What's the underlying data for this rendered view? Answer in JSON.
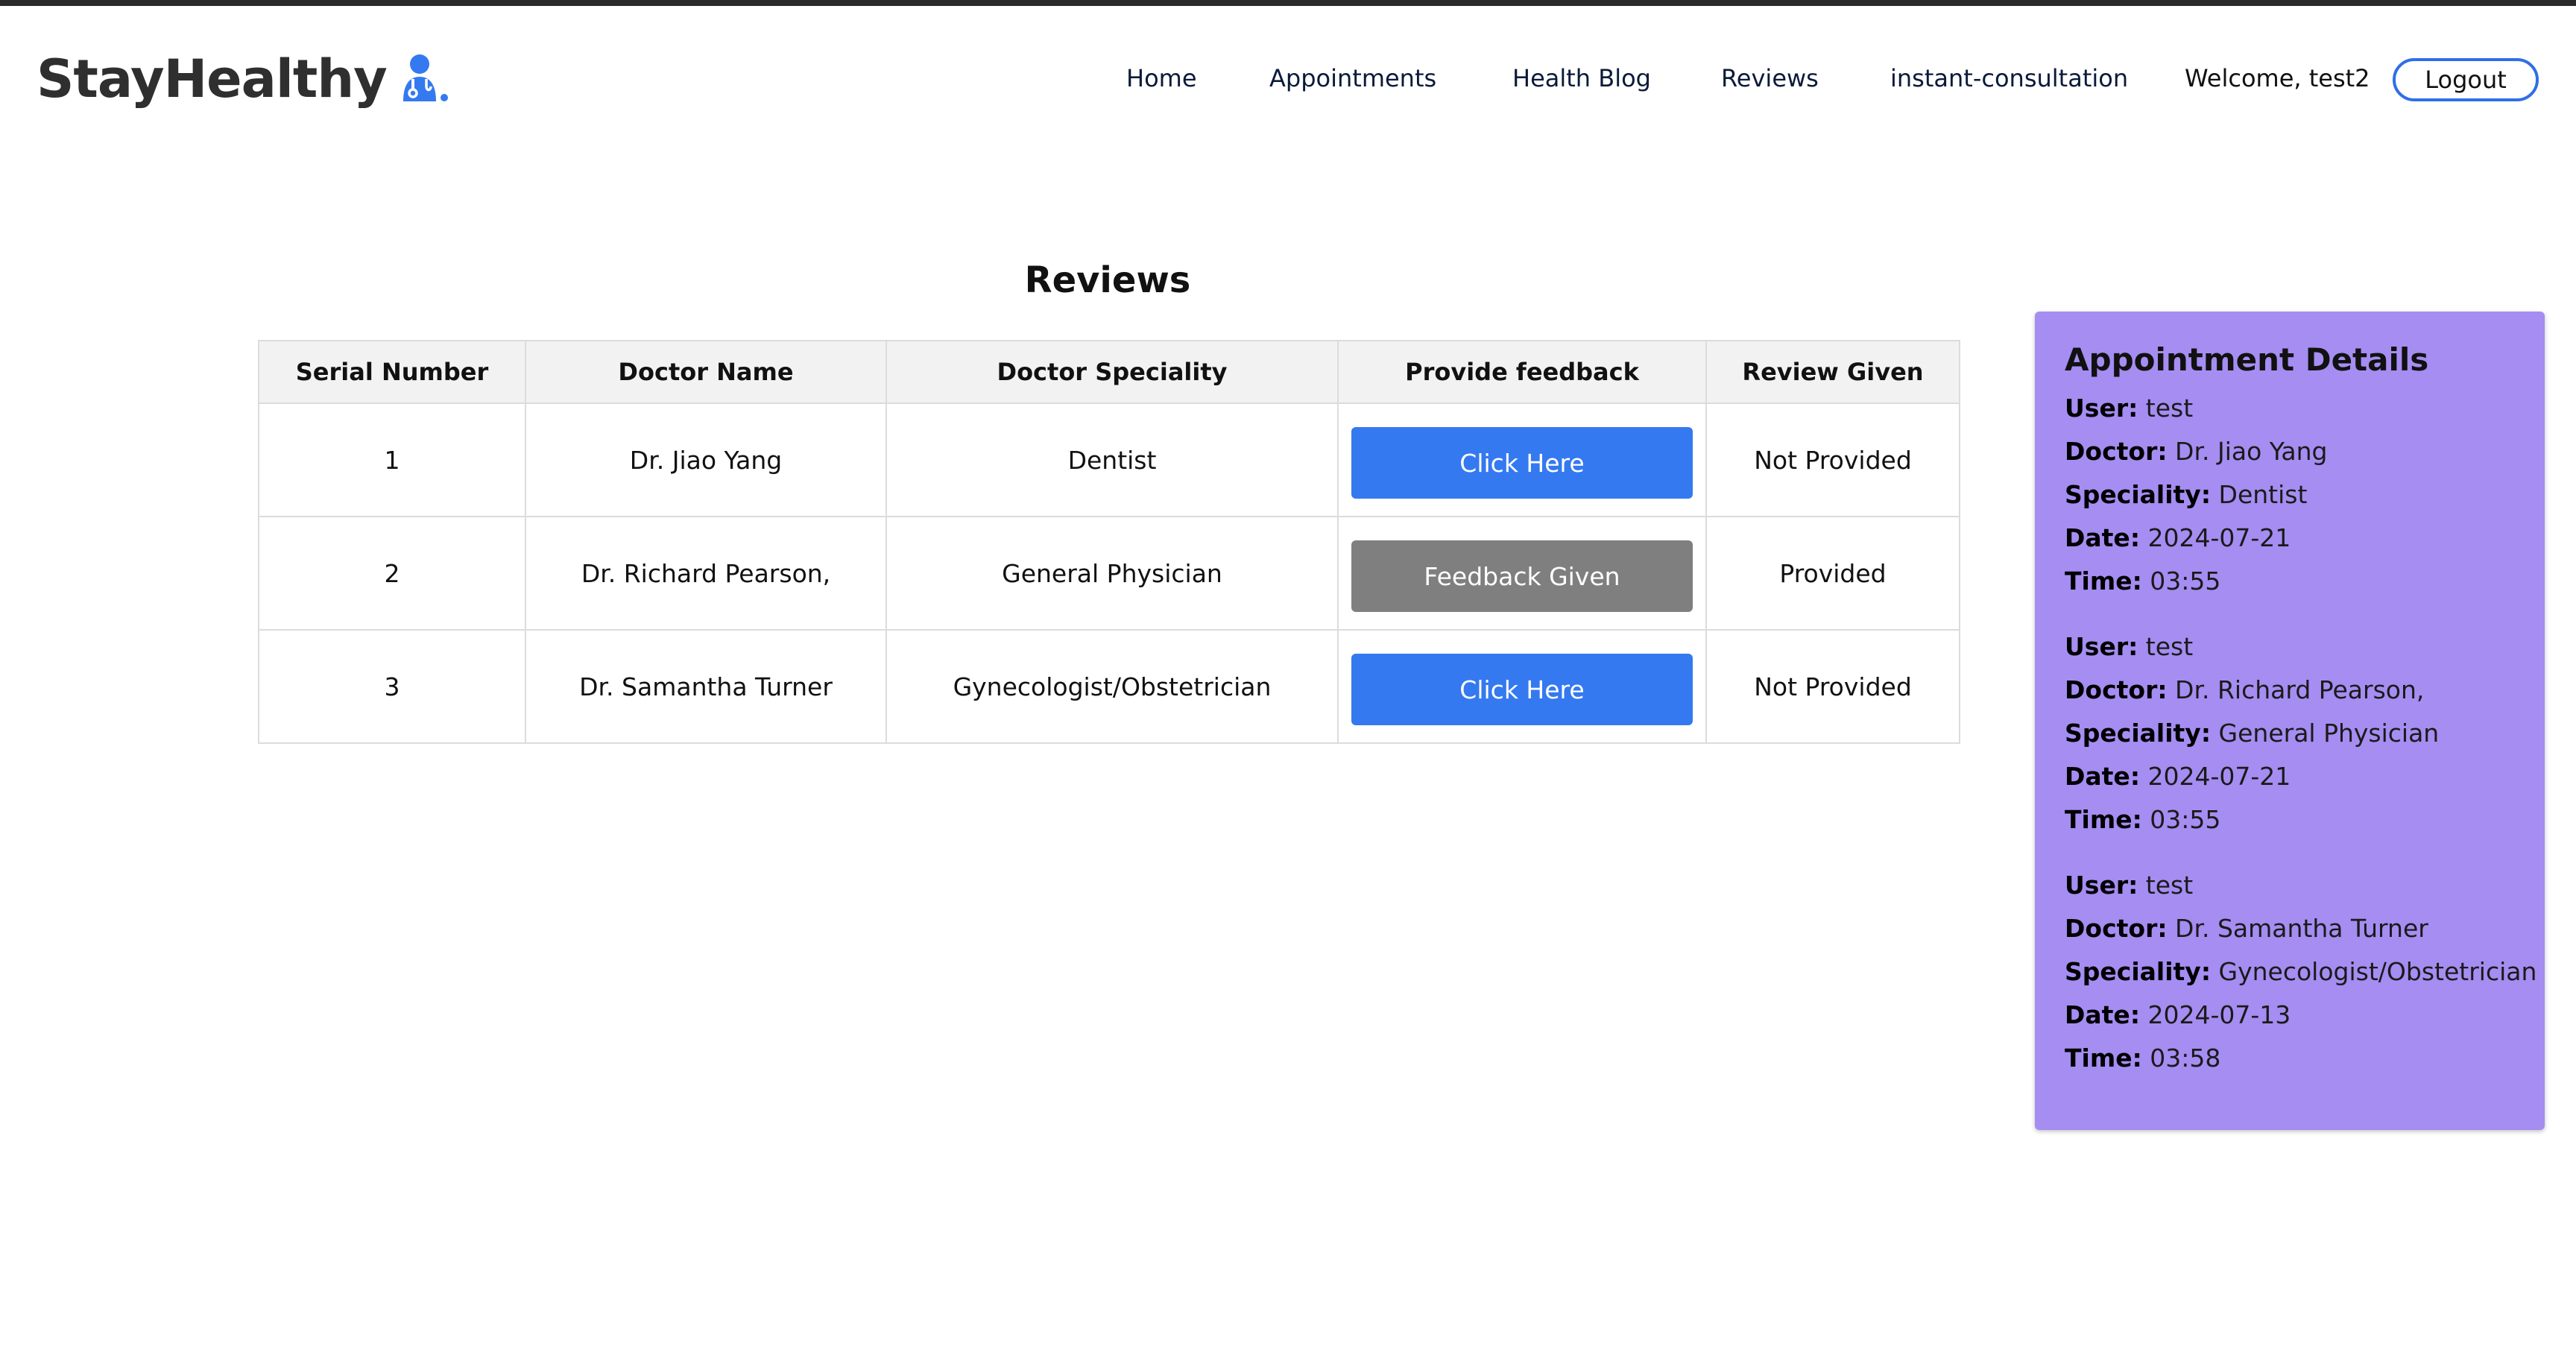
{
  "brand": {
    "name": "StayHealthy",
    "logo_icon": "doctor-icon",
    "logo_color": "#3479f0"
  },
  "nav": {
    "links": [
      {
        "label": "Home"
      },
      {
        "label": "Appointments"
      },
      {
        "label": "Health Blog"
      },
      {
        "label": "Reviews"
      },
      {
        "label": "instant-consultation"
      }
    ],
    "welcome": "Welcome, test2",
    "logout_label": "Logout"
  },
  "main": {
    "title": "Reviews",
    "table": {
      "headers": [
        "Serial Number",
        "Doctor Name",
        "Doctor Speciality",
        "Provide feedback",
        "Review Given"
      ],
      "rows": [
        {
          "serial": "1",
          "doctor": "Dr. Jiao Yang",
          "speciality": "Dentist",
          "action": "Click Here",
          "action_state": "enabled",
          "review": "Not Provided"
        },
        {
          "serial": "2",
          "doctor": "Dr. Richard Pearson,",
          "speciality": "General Physician",
          "action": "Feedback Given",
          "action_state": "disabled",
          "review": "Provided"
        },
        {
          "serial": "3",
          "doctor": "Dr. Samantha Turner",
          "speciality": "Gynecologist/Obstetrician",
          "action": "Click Here",
          "action_state": "enabled",
          "review": "Not Provided"
        }
      ]
    }
  },
  "side_panel": {
    "title": "Appointment Details",
    "labels": {
      "user": "User:",
      "doctor": "Doctor:",
      "speciality": "Speciality:",
      "date": "Date:",
      "time": "Time:"
    },
    "appointments": [
      {
        "user": "test",
        "doctor": "Dr. Jiao Yang",
        "speciality": "Dentist",
        "date": "2024-07-21",
        "time": "03:55"
      },
      {
        "user": "test",
        "doctor": "Dr. Richard Pearson,",
        "speciality": "General Physician",
        "date": "2024-07-21",
        "time": "03:55"
      },
      {
        "user": "test",
        "doctor": "Dr. Samantha Turner",
        "speciality": "Gynecologist/Obstetrician",
        "date": "2024-07-13",
        "time": "03:58"
      }
    ]
  },
  "colors": {
    "primary_button": "#3479f0",
    "disabled_button": "#7f7f7f",
    "panel_background": "#a58df2",
    "logout_border": "#2f6fe6"
  }
}
